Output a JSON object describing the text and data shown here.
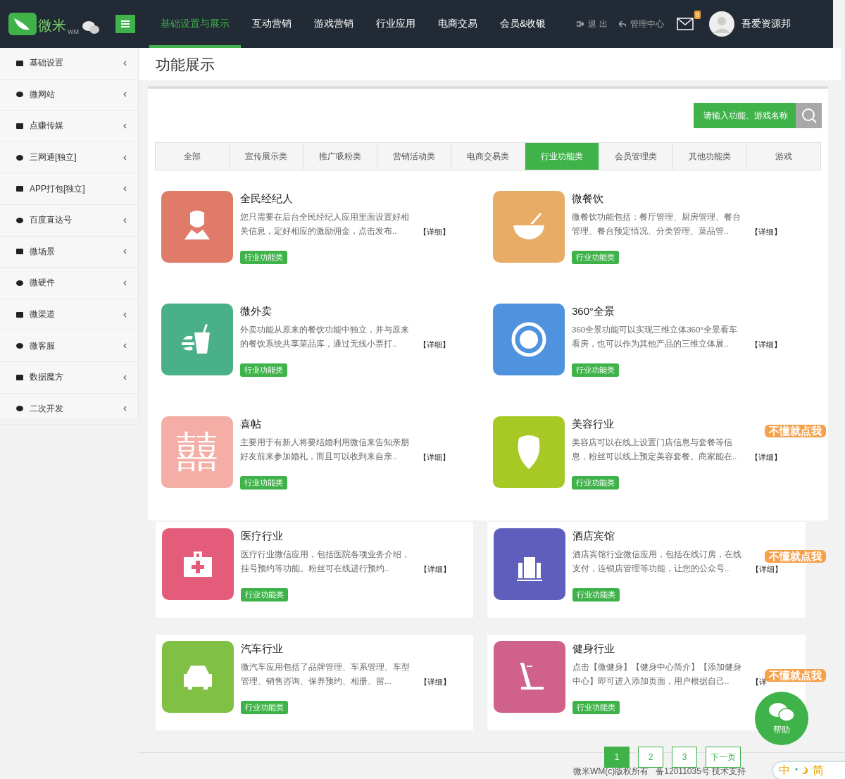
{
  "logo": {
    "name": "微米",
    "suffix": "WM"
  },
  "nav": [
    {
      "label": "基础设置与展示",
      "selected": true
    },
    {
      "label": "互动营销",
      "selected": false
    },
    {
      "label": "游戏营销",
      "selected": false
    },
    {
      "label": "行业应用",
      "selected": false
    },
    {
      "label": "电商交易",
      "selected": false
    },
    {
      "label": "会员&收银",
      "selected": false
    }
  ],
  "user_links": [
    {
      "label": "退 出"
    },
    {
      "label": "管理中心"
    }
  ],
  "mail_badge": "0",
  "user_name": "吾爱资源邦",
  "sidebar": [
    {
      "label": "基础设置"
    },
    {
      "label": "微网站"
    },
    {
      "label": "点赚传媒"
    },
    {
      "label": "三网通[独立]"
    },
    {
      "label": "APP打包[独立]"
    },
    {
      "label": "百度直达号"
    },
    {
      "label": "微场景"
    },
    {
      "label": "微硬件"
    },
    {
      "label": "微渠道"
    },
    {
      "label": "微客服"
    },
    {
      "label": "数据魔方"
    },
    {
      "label": "二次开发"
    }
  ],
  "page_title": "功能展示",
  "search": {
    "placeholder": "请输入功能、游戏名称"
  },
  "tabs": [
    {
      "label": "全部",
      "selected": false
    },
    {
      "label": "宣传展示类",
      "selected": false
    },
    {
      "label": "推广吸粉类",
      "selected": false
    },
    {
      "label": "营销活动类",
      "selected": false
    },
    {
      "label": "电商交易类",
      "selected": false
    },
    {
      "label": "行业功能类",
      "selected": true
    },
    {
      "label": "会员管理类",
      "selected": false
    },
    {
      "label": "其他功能类",
      "selected": false
    },
    {
      "label": "游戏",
      "selected": false
    }
  ],
  "cards": [
    {
      "title": "全民经纪人",
      "desc": "您只需要在后台全民经纪人应用里面设置好相关信息，定好相应的激励佣金，点击发布..",
      "detail": "【详细】",
      "tag": "行业功能类",
      "color": "#e07b6a"
    },
    {
      "title": "微餐饮",
      "desc": "微餐饮功能包括：餐厅管理、厨房管理、餐台管理、餐台预定情况、分类管理、菜品管..",
      "detail": "【详细】",
      "tag": "行业功能类",
      "color": "#e8ac66"
    },
    {
      "title": "微外卖",
      "desc": "外卖功能从原来的餐饮功能中独立，并与原来的餐饮系统共享菜品库，通过无线小票打..",
      "detail": "【详细】",
      "tag": "行业功能类",
      "color": "#4ab08a"
    },
    {
      "title": "360°全景",
      "desc": "360全景功能可以实现三维立体360°全景看车看房，也可以作为其他产品的三维立体展..",
      "detail": "【详细】",
      "tag": "行业功能类",
      "color": "#4f93de"
    },
    {
      "title": "喜帖",
      "desc": "主要用于有新人将要结婚利用微信来告知亲朋好友前来参加婚礼，而且可以收到来自亲..",
      "detail": "【详细】",
      "tag": "行业功能类",
      "color": "#f4aea6",
      "glyph": "囍"
    },
    {
      "title": "美容行业",
      "desc": "美容店可以在线上设置门店信息与套餐等信息，粉丝可以线上预定美容套餐。商家能在..",
      "detail": "【详细】",
      "tag": "行业功能类",
      "color": "#a8c925"
    },
    {
      "title": "医疗行业",
      "desc": "医疗行业微信应用，包括医院各项业务介绍，挂号预约等功能。粉丝可在线进行预约..",
      "detail": "【详细】",
      "tag": "行业功能类",
      "color": "#e35d7a"
    },
    {
      "title": "酒店宾馆",
      "desc": "酒店宾馆行业微信应用，包括在线订房，在线支付，连锁店管理等功能，让您的公众号..",
      "detail": "【详细】",
      "tag": "行业功能类",
      "color": "#5e5fbd"
    },
    {
      "title": "汽车行业",
      "desc": "微汽车应用包括了品牌管理、车系管理、车型管理、销售咨询、保养预约、相册、留...",
      "detail": "【详细】",
      "tag": "行业功能类",
      "color": "#80c044"
    },
    {
      "title": "健身行业",
      "desc": "点击【微健身】【健身中心简介】【添加健身中心】即可进入添加页面，用户根据自己..",
      "detail": "【详",
      "tag": "行业功能类",
      "color": "#d0618b"
    }
  ],
  "float_badges": [
    "不懂就点我",
    "不懂就点我",
    "不懂就点我"
  ],
  "help": "帮助",
  "pagination": [
    {
      "label": "1",
      "selected": true
    },
    {
      "label": "2",
      "selected": false
    },
    {
      "label": "3",
      "selected": false
    },
    {
      "label": "下一页",
      "selected": false
    }
  ],
  "footer": [
    "微米WM(c)版权所有",
    "备12011035号 技术支持"
  ],
  "ime": [
    "中",
    "简"
  ]
}
